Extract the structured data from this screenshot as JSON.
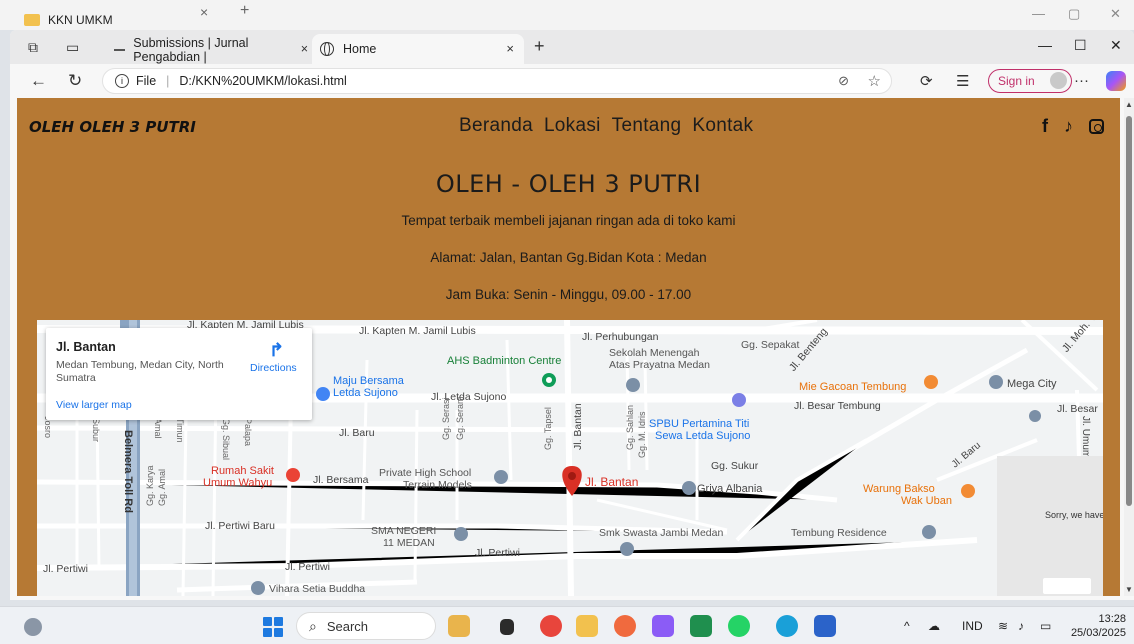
{
  "background_window": {
    "tab_title": "KKN UMKM",
    "close": "×",
    "new_tab": "+"
  },
  "browser": {
    "tabs": [
      {
        "label": "Submissions | Jurnal Pengabdian |",
        "close": "×"
      },
      {
        "label": "Home",
        "close": "×"
      }
    ],
    "new_tab": "+",
    "address": {
      "info": "i",
      "scheme_label": "File",
      "url": "D:/KKN%20UMKM/lokasi.html"
    },
    "sign_in": "Sign in",
    "more": "···"
  },
  "site": {
    "brand": "OLEH OLEH 3 PUTRI",
    "nav": [
      "Beranda",
      "Lokasi",
      "Tentang",
      "Kontak"
    ],
    "socials": [
      "facebook-icon",
      "tiktok-icon",
      "instagram-icon"
    ],
    "hero": {
      "title": "OLEH - OLEH 3 PUTRI",
      "tagline": "Tempat terbaik membeli jajanan ringan ada di toko kami",
      "address": "Alamat: Jalan, Bantan Gg.Bidan Kota : Medan",
      "hours": "Jam Buka: Senin - Minggu, 09.00 - 17.00"
    },
    "map": {
      "place_title": "Jl. Bantan",
      "place_address": "Medan Tembung, Medan City, North Sumatra",
      "directions": "Directions",
      "larger_map": "View larger map",
      "error_text": "Sorry, we have",
      "labels": {
        "kapten_jamil_lubis_top": "Jl. Kapten M. Jamil Lubis",
        "kapten_jamil_lubis": "Jl. Kapten M. Jamil Lubis",
        "perhubungan": "Jl. Perhubungan",
        "sepakat": "Gg. Sepakat",
        "benteng": "Jl. Benteng",
        "moh": "Jl. Moh. Ya",
        "ahs": "AHS Badminton Centre",
        "sekolah": "Sekolah Menengah",
        "sekolah2": "Atas Prayatna Medan",
        "maju": "Maju Bersama",
        "maju2": "Letda Sujono",
        "letda": "Jl. Letda Sujono",
        "mie": "Mie Gacoan Tembung",
        "besar_tembung": "Jl. Besar Tembung",
        "mega": "Mega City",
        "jl_besar": "Jl. Besar",
        "spbu": "SPBU Pertamina Titi",
        "spbu2": "Sewa Letda Sujono",
        "baru": "Jl. Baru",
        "bantan_v": "Jl. Bantan",
        "rs": "Rumah Sakit",
        "rs2": "Umum Wahyu",
        "bersama": "Jl. Bersama",
        "private": "Private High School",
        "private2": "Terrain Models",
        "pin_label": "Jl. Bantan",
        "sukur": "Gg. Sukur",
        "griya": "Griya Albania",
        "warung": "Warung Bakso",
        "warung2": "Wak Uban",
        "tol": "Belmera Toll Rd",
        "pertiwi_baru": "Jl. Pertiwi Baru",
        "sma": "SMA NEGERI",
        "sma2": "11 MEDAN",
        "pertiwi": "Jl. Pertiwi",
        "smk": "Smk Swasta Jambi Medan",
        "tembung_res": "Tembung Residence",
        "pertiwi_left": "Jl. Pertiwi",
        "pertiwi_mid": "Jl. Pertiwi",
        "vihara": "Vihara Setia Buddha",
        "josro": "Josro",
        "subur": "Subur",
        "amal": "Amal",
        "timun": "Timun",
        "sibual": "Gg. Sibual",
        "palapa": "Palapa",
        "serasi": "Gg. Serasi",
        "seram": "Gg. Seram",
        "tapsel": "Gg. Tapsel",
        "sahlan": "Gg. Sahlan",
        "idris": "Gg. M. Idris",
        "karya": "Gg. Karya",
        "amal2": "Gg. Amal",
        "umum": "Jl. Umum",
        "baru2": "Jl. Baru"
      }
    }
  },
  "taskbar": {
    "search": "Search",
    "lang": "IND",
    "time": "13:28",
    "date": "25/03/2025"
  },
  "colors": {
    "page_bg": "#b67934",
    "map_road": "#ffffff",
    "pin": "#d93025",
    "link": "#1a73e8"
  }
}
